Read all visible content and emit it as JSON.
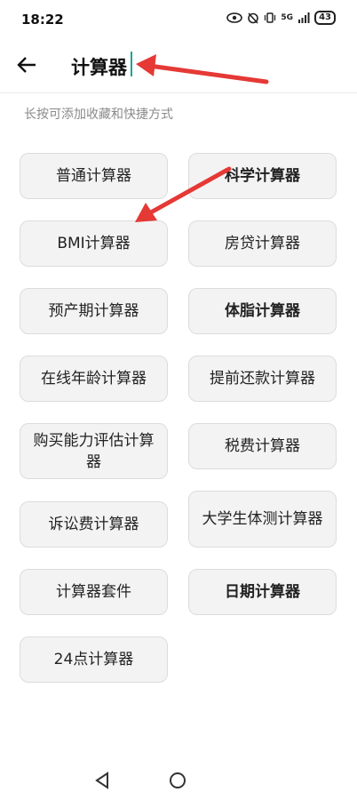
{
  "status_bar": {
    "time": "18:22",
    "network": "5G",
    "battery": "43"
  },
  "search": {
    "query": "计算器",
    "back_icon": "arrow-left-icon"
  },
  "hint": "长按可添加收藏和快捷方式",
  "buttons": [
    {
      "label": "普通计算器",
      "bold": false
    },
    {
      "label": "科学计算器",
      "bold": true
    },
    {
      "label": "BMI计算器",
      "bold": false
    },
    {
      "label": "房贷计算器",
      "bold": false
    },
    {
      "label": "预产期计算器",
      "bold": false
    },
    {
      "label": "体脂计算器",
      "bold": true
    },
    {
      "label": "在线年龄计算器",
      "bold": false
    },
    {
      "label": "提前还款计算器",
      "bold": false
    },
    {
      "label": "购买能力评估计算器",
      "bold": false
    },
    {
      "label": "税费计算器",
      "bold": false
    },
    {
      "label": "诉讼费计算器",
      "bold": false
    },
    {
      "label": "大学生体测计算器",
      "bold": false
    },
    {
      "label": "计算器套件",
      "bold": false
    },
    {
      "label": "日期计算器",
      "bold": true
    },
    {
      "label": "24点计算器",
      "bold": false
    }
  ],
  "annotation_color": "#e53935"
}
